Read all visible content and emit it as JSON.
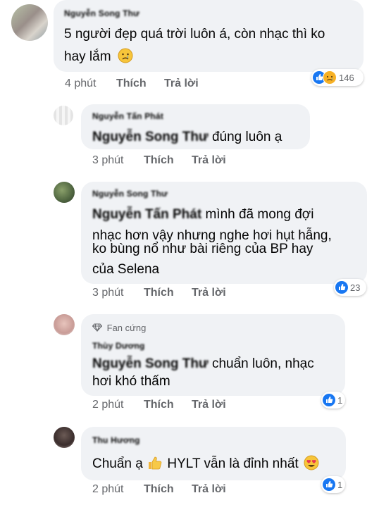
{
  "comments": [
    {
      "author": "Nguyễn Song Thư",
      "text_lines": [
        "5 người đẹp quá trời luôn á, còn nhạc thì ko",
        "hay lắm"
      ],
      "emoji": "crying-emoji",
      "time": "4 phút",
      "like": "Thích",
      "reply": "Trả lời",
      "reactions": [
        "like",
        "sad"
      ],
      "reaction_count": "146"
    },
    {
      "author": "Nguyễn Tấn Phát",
      "mention": "Nguyễn Song Thư",
      "text_after": "đúng luôn ạ",
      "time": "3 phút",
      "like": "Thích",
      "reply": "Trả lời"
    },
    {
      "author": "Nguyễn Song Thư",
      "mention": "Nguyễn Tấn Phát",
      "text_after": "mình đã mong đợi",
      "text_lines": [
        "nhạc hơn vậy nhưng nghe hơi hụt hẫng,",
        "ko bùng nổ như bài riêng của BP hay",
        "của Selena"
      ],
      "time": "3 phút",
      "like": "Thích",
      "reply": "Trả lời",
      "reactions": [
        "like"
      ],
      "reaction_count": "23"
    },
    {
      "badge": "Fan cứng",
      "author": "Thùy Dương",
      "mention": "Nguyễn Song Thư",
      "text_after": "chuẩn luôn, nhạc",
      "text_lines": [
        "hơi khó thấm"
      ],
      "time": "2 phút",
      "like": "Thích",
      "reply": "Trả lời",
      "reactions": [
        "like"
      ],
      "reaction_count": "1"
    },
    {
      "author": "Thu Hương",
      "text_before": "Chuẩn ạ",
      "text_after": "HYLT vẫn là đỉnh nhất",
      "time": "2 phút",
      "like": "Thích",
      "reply": "Trả lời",
      "reactions": [
        "like"
      ],
      "reaction_count": "1"
    }
  ],
  "colors": {
    "bubble": "#f0f2f5",
    "meta": "#65676b",
    "like": "#1877f2",
    "text": "#050505"
  },
  "icons": [
    "like-icon",
    "sad-icon",
    "diamond-icon",
    "crying-emoji",
    "thumbs-up-emoji",
    "heart-eyes-emoji"
  ]
}
